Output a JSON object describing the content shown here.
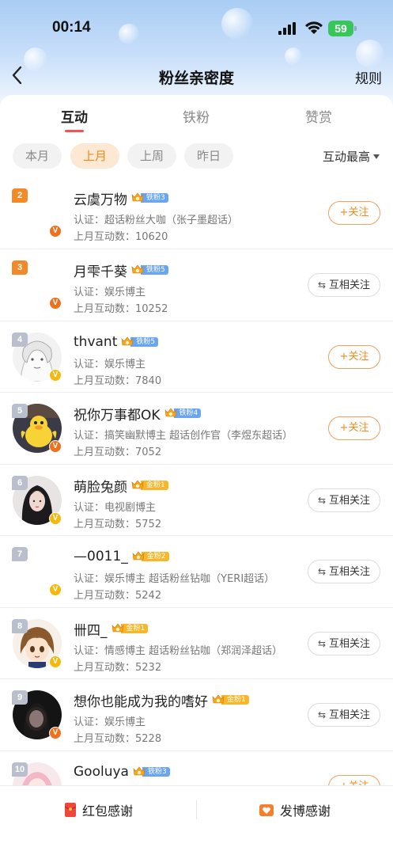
{
  "status_bar": {
    "time": "00:14",
    "battery": "59"
  },
  "nav": {
    "title": "粉丝亲密度",
    "rules": "规则"
  },
  "tabs": [
    {
      "label": "互动",
      "active": true
    },
    {
      "label": "铁粉",
      "active": false
    },
    {
      "label": "赞赏",
      "active": false
    }
  ],
  "filters": {
    "chips": [
      {
        "label": "本月",
        "active": false
      },
      {
        "label": "上月",
        "active": true
      },
      {
        "label": "上周",
        "active": false
      },
      {
        "label": "昨日",
        "active": false
      }
    ],
    "sort": "互动最高"
  },
  "fans": [
    {
      "rank": "2",
      "name": "云虞万物",
      "badge": "铁粉3",
      "badge_color": "blue",
      "cert": "认证：超话粉丝大咖（张子墨超话）",
      "count": "上月互动数：10620",
      "button": "+关注",
      "button_type": "follow",
      "verified": "orange",
      "avatar": "blank"
    },
    {
      "rank": "3",
      "name": "月雫千葵",
      "badge": "铁粉5",
      "badge_color": "blue",
      "cert": "认证：娱乐博主",
      "count": "上月互动数：10252",
      "button": "互相关注",
      "button_type": "mutual",
      "verified": "orange",
      "avatar": "blank"
    },
    {
      "rank": "4",
      "name": "thvant",
      "badge": "铁粉5",
      "badge_color": "blue",
      "cert": "认证：娱乐博主",
      "count": "上月互动数：7840",
      "button": "+关注",
      "button_type": "follow",
      "verified": "yellow",
      "avatar": "sketch"
    },
    {
      "rank": "5",
      "name": "祝你万事都OK",
      "badge": "铁粉4",
      "badge_color": "blue",
      "cert": "认证：搞笑幽默博主 超话创作官（李煜东超话）",
      "count": "上月互动数：7052",
      "button": "+关注",
      "button_type": "follow",
      "verified": "orange",
      "avatar": "duck"
    },
    {
      "rank": "6",
      "name": "萌脸兔颜",
      "badge": "金粉1",
      "badge_color": "gold",
      "cert": "认证：电视剧博主",
      "count": "上月互动数：5752",
      "button": "互相关注",
      "button_type": "mutual",
      "verified": "yellow",
      "avatar": "girl-dark"
    },
    {
      "rank": "7",
      "name": "—0011_",
      "badge": "金粉2",
      "badge_color": "gold",
      "cert": "认证：娱乐博主 超话粉丝钻咖（YERI超话）",
      "count": "上月互动数：5242",
      "button": "互相关注",
      "button_type": "mutual",
      "verified": "yellow",
      "avatar": "blank"
    },
    {
      "rank": "8",
      "name": "卌四_",
      "badge": "金粉1",
      "badge_color": "gold",
      "cert": "认证：情感博主 超话粉丝钻咖（郑润泽超话）",
      "count": "上月互动数：5232",
      "button": "互相关注",
      "button_type": "mutual",
      "verified": "yellow",
      "avatar": "anime"
    },
    {
      "rank": "9",
      "name": "想你也能成为我的嗜好",
      "badge": "金粉1",
      "badge_color": "gold",
      "cert": "认证：娱乐博主",
      "count": "上月互动数：5228",
      "button": "互相关注",
      "button_type": "mutual",
      "verified": "orange",
      "avatar": "dark"
    },
    {
      "rank": "10",
      "name": "Gooluya",
      "badge": "铁粉3",
      "badge_color": "blue",
      "cert": "",
      "count": "",
      "button": "+关注",
      "button_type": "follow",
      "verified": "",
      "avatar": "pink"
    }
  ],
  "bottom_bar": {
    "red_packet": "红包感谢",
    "post": "发博感谢"
  },
  "colors": {
    "accent": "#f08a1c",
    "tab_indicator": "#f05454",
    "iron_badge": "#6aa5f2",
    "gold_badge": "#f8b62a"
  }
}
